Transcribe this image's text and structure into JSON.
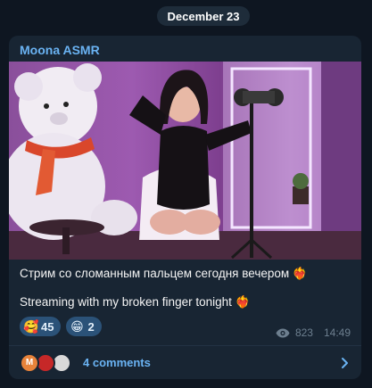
{
  "date_separator": "December 23",
  "post": {
    "channel_name": "Moona ASMR",
    "text_ru": "Стрим со сломанным пальцем сегодня вечером",
    "text_en": "Streaming with my broken finger tonight",
    "text_emoji": "❤️‍🔥",
    "reactions": [
      {
        "emoji": "🥰",
        "count": "45"
      },
      {
        "emoji": "😁",
        "count": "2"
      }
    ],
    "views": "823",
    "time": "14:49"
  },
  "comments": {
    "label": "4 comments",
    "avatars": [
      {
        "initial": "M",
        "color": "#e8833a"
      },
      {
        "initial": "",
        "color": "#c62828"
      },
      {
        "initial": "",
        "color": "#e0e0e0"
      }
    ]
  },
  "colors": {
    "background": "#0e1621",
    "bubble": "#182533",
    "accent": "#6ab3f3",
    "reaction_bg": "#2b5278"
  }
}
